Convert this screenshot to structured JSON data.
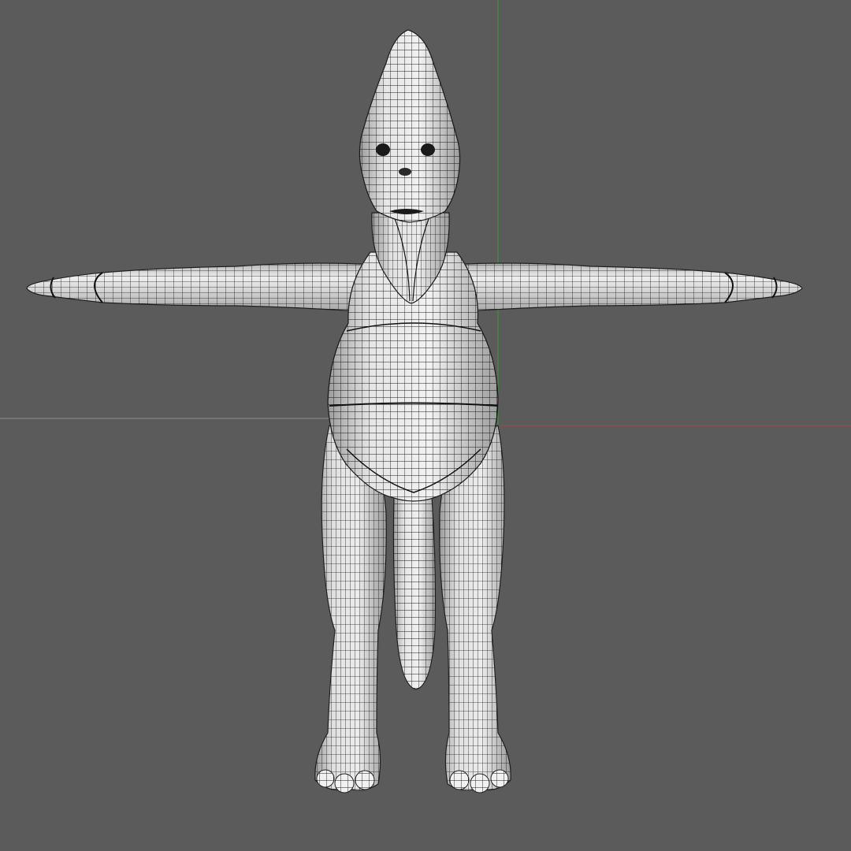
{
  "viewport": {
    "background_color": "#5b5b5b",
    "axis_x_color": "#a04a4a",
    "axis_y_color": "#3f9a3f",
    "axis_ref_color": "#909090",
    "mesh_fill_color": "#f2f2f2",
    "mesh_shade_color": "#c9c9c9",
    "wire_color": "#1a1a1a",
    "view_mode": "wireframe-on-shaded",
    "model_pose": "T-pose",
    "model": "creature-mesh"
  }
}
